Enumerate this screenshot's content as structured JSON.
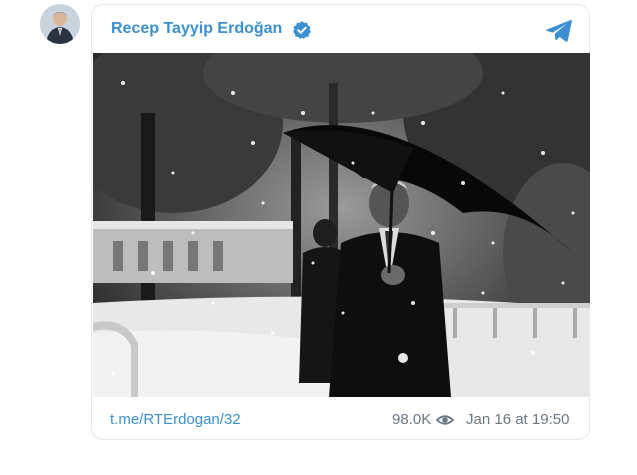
{
  "post": {
    "channel_name": "Recep Tayyip Erdoğan",
    "verified": true,
    "link_text": "t.me/RTErdogan/32",
    "views": "98.0K",
    "date": "Jan 16 at 19:50"
  },
  "icons": {
    "verified": "verified-badge-icon",
    "telegram": "telegram-logo-icon",
    "views": "eye-icon"
  },
  "colors": {
    "accent": "#3a90d0",
    "meta_text": "#6c7883",
    "card_border": "#e3e8ee"
  }
}
